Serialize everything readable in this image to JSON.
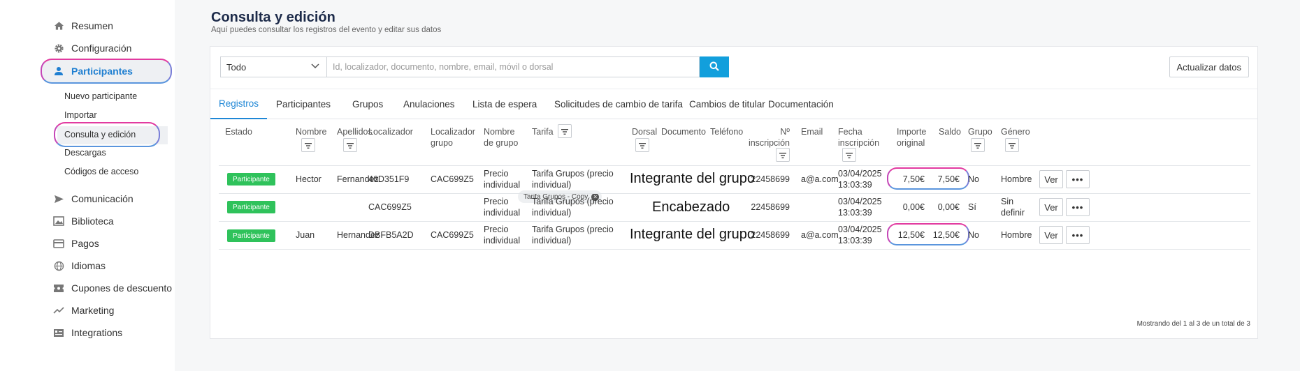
{
  "sidebar": {
    "items": [
      {
        "label": "Resumen",
        "icon": "home-icon"
      },
      {
        "label": "Configuración",
        "icon": "gear-icon"
      },
      {
        "label": "Participantes",
        "icon": "user-icon"
      },
      {
        "label": "Comunicación",
        "icon": "send-icon"
      },
      {
        "label": "Biblioteca",
        "icon": "image-library-icon"
      },
      {
        "label": "Pagos",
        "icon": "card-icon"
      },
      {
        "label": "Idiomas",
        "icon": "globe-icon"
      },
      {
        "label": "Cupones de descuento",
        "icon": "ticket-icon"
      },
      {
        "label": "Marketing",
        "icon": "trend-icon"
      },
      {
        "label": "Integrations",
        "icon": "integrations-icon"
      }
    ],
    "sub_items": [
      "Nuevo participante",
      "Importar",
      "Consulta y edición",
      "Descargas",
      "Códigos de acceso"
    ]
  },
  "header": {
    "title": "Consulta y edición",
    "subtitle": "Aquí puedes consultar los registros del evento y editar sus datos"
  },
  "search": {
    "filter_value": "Todo",
    "placeholder": "Id, localizador, documento, nombre, email, móvil o dorsal",
    "refresh_label": "Actualizar datos"
  },
  "tabs": [
    "Registros",
    "Participantes",
    "Grupos",
    "Anulaciones",
    "Lista de espera",
    "Solicitudes de cambio de tarifa",
    "Cambios de titular",
    "Documentación"
  ],
  "columns": {
    "estado": "Estado",
    "nombre": "Nombre",
    "apellidos": "Apellidos",
    "localizador": "Localizador",
    "localizador_grupo": "Localizador grupo",
    "nombre_grupo": "Nombre de grupo",
    "tarifa": "Tarifa",
    "dorsal": "Dorsal",
    "documento": "Documento",
    "telefono": "Teléfono",
    "n_inscripcion": "Nº inscripción",
    "email": "Email",
    "fecha_inscripcion": "Fecha inscripción",
    "importe_original": "Importe original",
    "saldo": "Saldo",
    "grupo": "Grupo",
    "genero": "Género"
  },
  "tarifa_filter_chip": "Tarifa Grupos - Copy",
  "rows": [
    {
      "estado": "Participante",
      "nombre": "Hector",
      "apellidos": "Fernandez",
      "localizador": "46D351F9",
      "localizador_grupo": "CAC699Z5",
      "nombre_grupo": "Precio individual",
      "tarifa": "Tarifa Grupos (precio individual)",
      "annotation": "Integrante del grupo",
      "n_inscripcion": "22458699",
      "email": "a@a.com",
      "fecha": "03/04/2025 13:03:39",
      "importe": "7,50€",
      "saldo": "7,50€",
      "grupo": "No",
      "genero": "Hombre"
    },
    {
      "estado": "Participante",
      "nombre": "",
      "apellidos": "",
      "localizador": "CAC699Z5",
      "localizador_grupo": "",
      "nombre_grupo": "Precio individual",
      "tarifa": "Tarifa Grupos (precio individual)",
      "annotation": "Encabezado",
      "n_inscripcion": "22458699",
      "email": "",
      "fecha": "03/04/2025 13:03:39",
      "importe": "0,00€",
      "saldo": "0,00€",
      "grupo": "Sí",
      "genero": "Sin definir"
    },
    {
      "estado": "Participante",
      "nombre": "Juan",
      "apellidos": "Hernandez",
      "localizador": "DBFB5A2D",
      "localizador_grupo": "CAC699Z5",
      "nombre_grupo": "Precio individual",
      "tarifa": "Tarifa Grupos (precio individual)",
      "annotation": "Integrante del grupo",
      "n_inscripcion": "22458699",
      "email": "a@a.com",
      "fecha": "03/04/2025 13:03:39",
      "importe": "12,50€",
      "saldo": "12,50€",
      "grupo": "No",
      "genero": "Hombre"
    }
  ],
  "actions": {
    "view_label": "Ver",
    "more_label": "•••"
  },
  "footer": "Mostrando del 1 al 3 de un total de 3"
}
